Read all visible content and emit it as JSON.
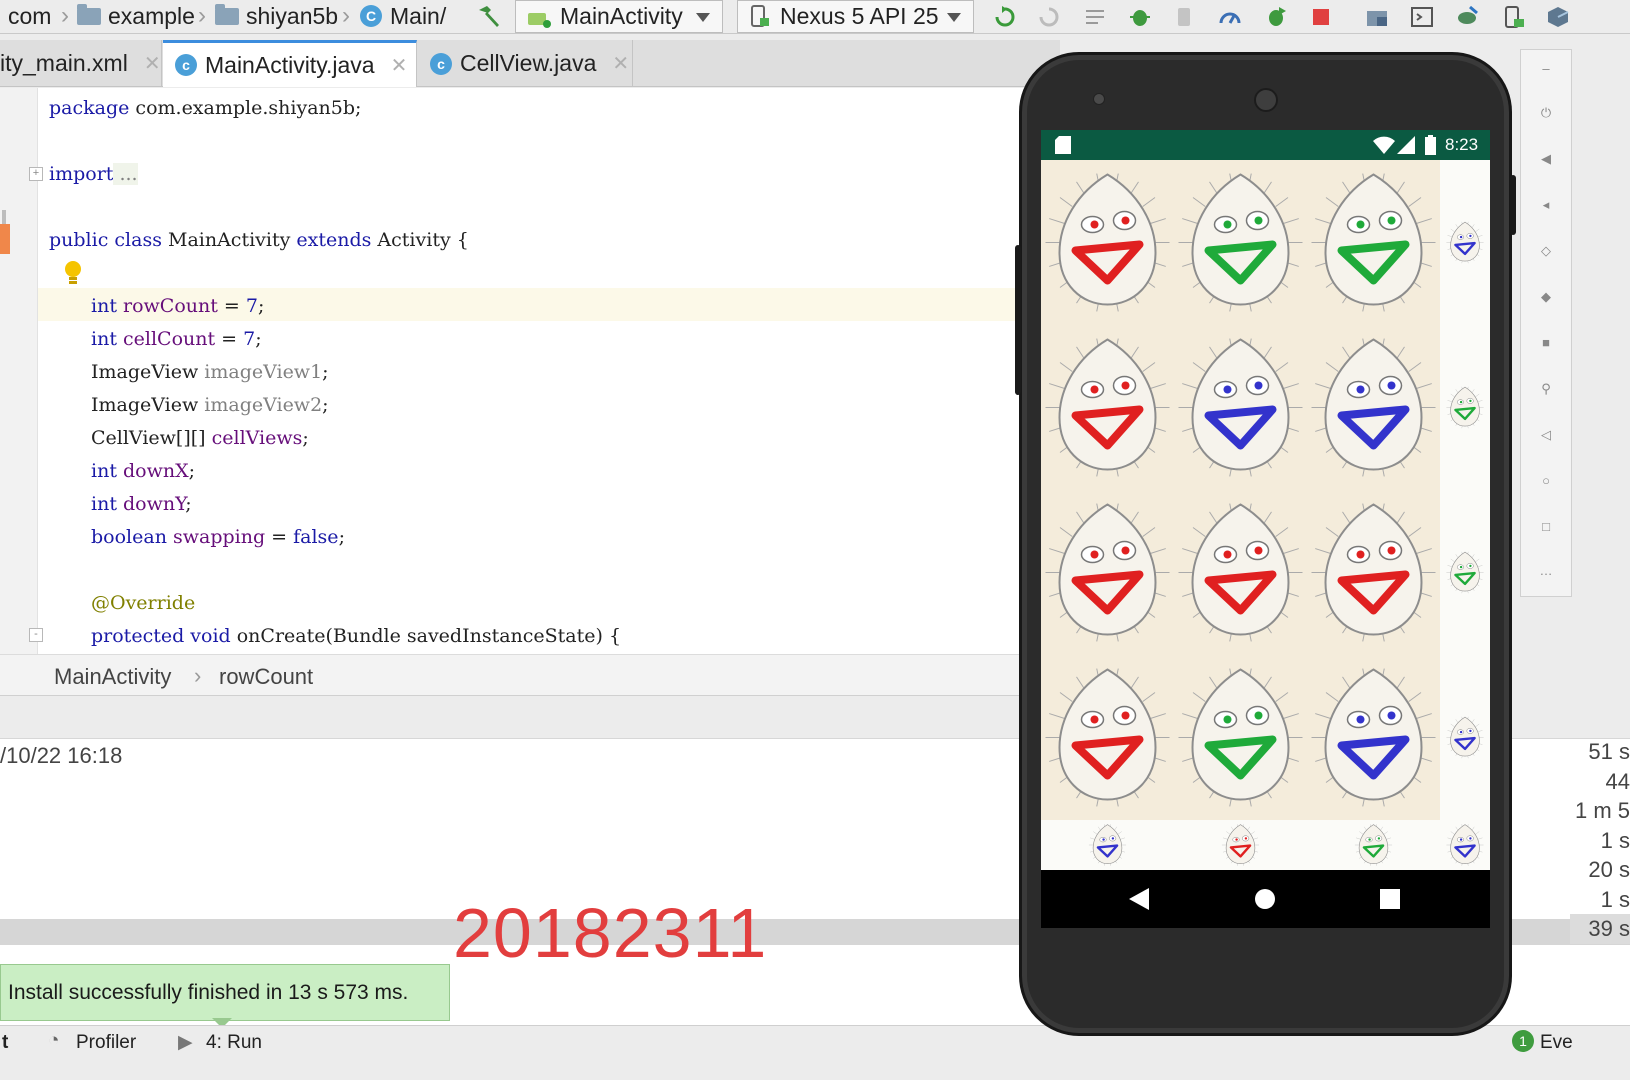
{
  "toolbar": {
    "breadcrumb": [
      "com",
      "example",
      "shiyan5b",
      "Main/"
    ],
    "run_config": "MainActivity",
    "device": "Nexus 5 API 25"
  },
  "tabs": [
    {
      "label": "ity_main.xml",
      "active": false
    },
    {
      "label": "MainActivity.java",
      "active": true
    },
    {
      "label": "CellView.java",
      "active": false
    }
  ],
  "code": {
    "l1_kw": "package",
    "l1_rest": " com.example.shiyan5b;",
    "l2_kw": "import",
    "l2_rest": " ...",
    "l3_kw1": "public class",
    "l3_name": " MainActivity ",
    "l3_kw2": "extends",
    "l3_rest": " Activity {",
    "l4_kw": "int",
    "l4_fld": " rowCount",
    "l4_eq": " = ",
    "l4_num": "7",
    "l4_end": ";",
    "l5_kw": "int",
    "l5_fld": " cellCount",
    "l5_eq": " = ",
    "l5_num": "7",
    "l5_end": ";",
    "l6_type": "ImageView",
    "l6_var": " imageView1",
    "l6_end": ";",
    "l7_type": "ImageView",
    "l7_var": " imageView2",
    "l7_end": ";",
    "l8_type": "CellView[][]",
    "l8_fld": " cellViews",
    "l8_end": ";",
    "l9_kw": "int",
    "l9_fld": " downX",
    "l9_end": ";",
    "l10_kw": "int",
    "l10_fld": " downY",
    "l10_end": ";",
    "l11_kw": "boolean",
    "l11_fld": " swapping",
    "l11_eq": " = ",
    "l11_val": "false",
    "l11_end": ";",
    "l12_ann": "@Override",
    "l13_kw": "protected void",
    "l13_rest": " onCreate(Bundle savedInstanceState) {"
  },
  "editor_breadcrumb": [
    "MainActivity",
    "rowCount"
  ],
  "run": {
    "timestamp": "/10/22 16:18",
    "timings": [
      "51 s",
      "44",
      "1 m 5",
      "1 s",
      "20 s",
      "1 s",
      "39 s"
    ],
    "student_id": "20182311"
  },
  "toast": {
    "message": "Install successfully finished in 13 s 573 ms."
  },
  "statusbar": {
    "items": [
      "t",
      "Profiler",
      "4: Run"
    ],
    "right": "Eve"
  },
  "android": {
    "time": "8:23"
  },
  "colors": {
    "accent": "#3c8dde",
    "android_status": "#0b5a42",
    "toast_bg": "#caeec4",
    "red_face": "#e02020",
    "green_face": "#1faa3a",
    "blue_face": "#3333cc"
  },
  "face_grid": [
    [
      "red",
      "green",
      "green",
      "blue"
    ],
    [
      "red",
      "blue",
      "blue",
      "green"
    ],
    [
      "red",
      "red",
      "red",
      "green"
    ],
    [
      "red",
      "green",
      "blue",
      "blue"
    ],
    [
      "blue",
      "red",
      "green",
      "blue"
    ]
  ]
}
